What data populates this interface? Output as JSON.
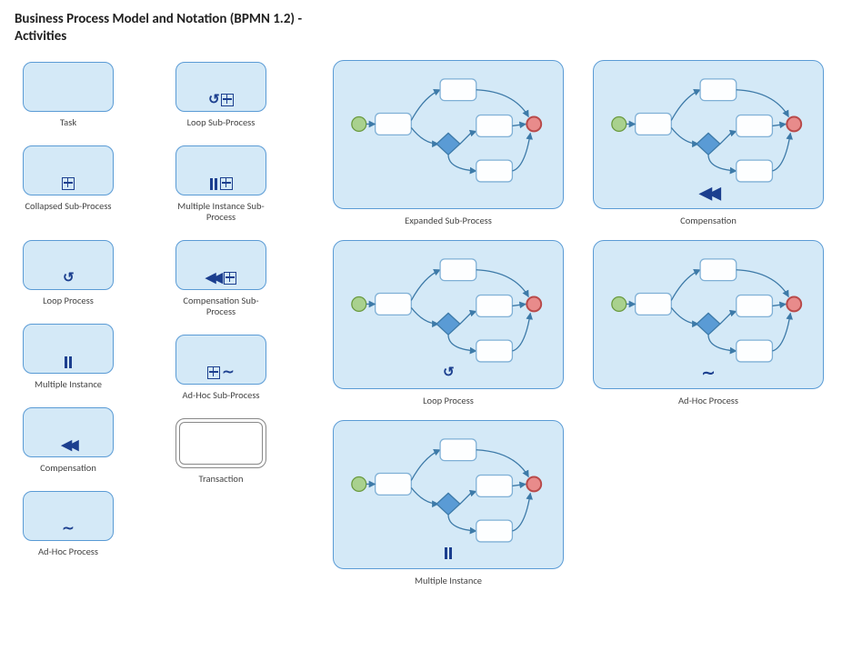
{
  "title": "Business Process Model and Notation (BPMN 1.2) - Activities",
  "small": [
    {
      "label": "Task"
    },
    {
      "label": "Collapsed Sub-Process"
    },
    {
      "label": "Loop Process"
    },
    {
      "label": "Multiple Instance"
    },
    {
      "label": "Compensation"
    },
    {
      "label": "Ad-Hoc Process"
    },
    {
      "label": "Loop Sub-Process"
    },
    {
      "label": "Multiple Instance Sub-Process"
    },
    {
      "label": "Compensation Sub-Process"
    },
    {
      "label": "Ad-Hoc Sub-Process"
    },
    {
      "label": "Transaction"
    }
  ],
  "big": [
    {
      "label": "Expanded Sub-Process"
    },
    {
      "label": "Loop Process"
    },
    {
      "label": "Multiple Instance"
    },
    {
      "label": "Compensation"
    },
    {
      "label": "Ad-Hoc Process"
    }
  ]
}
